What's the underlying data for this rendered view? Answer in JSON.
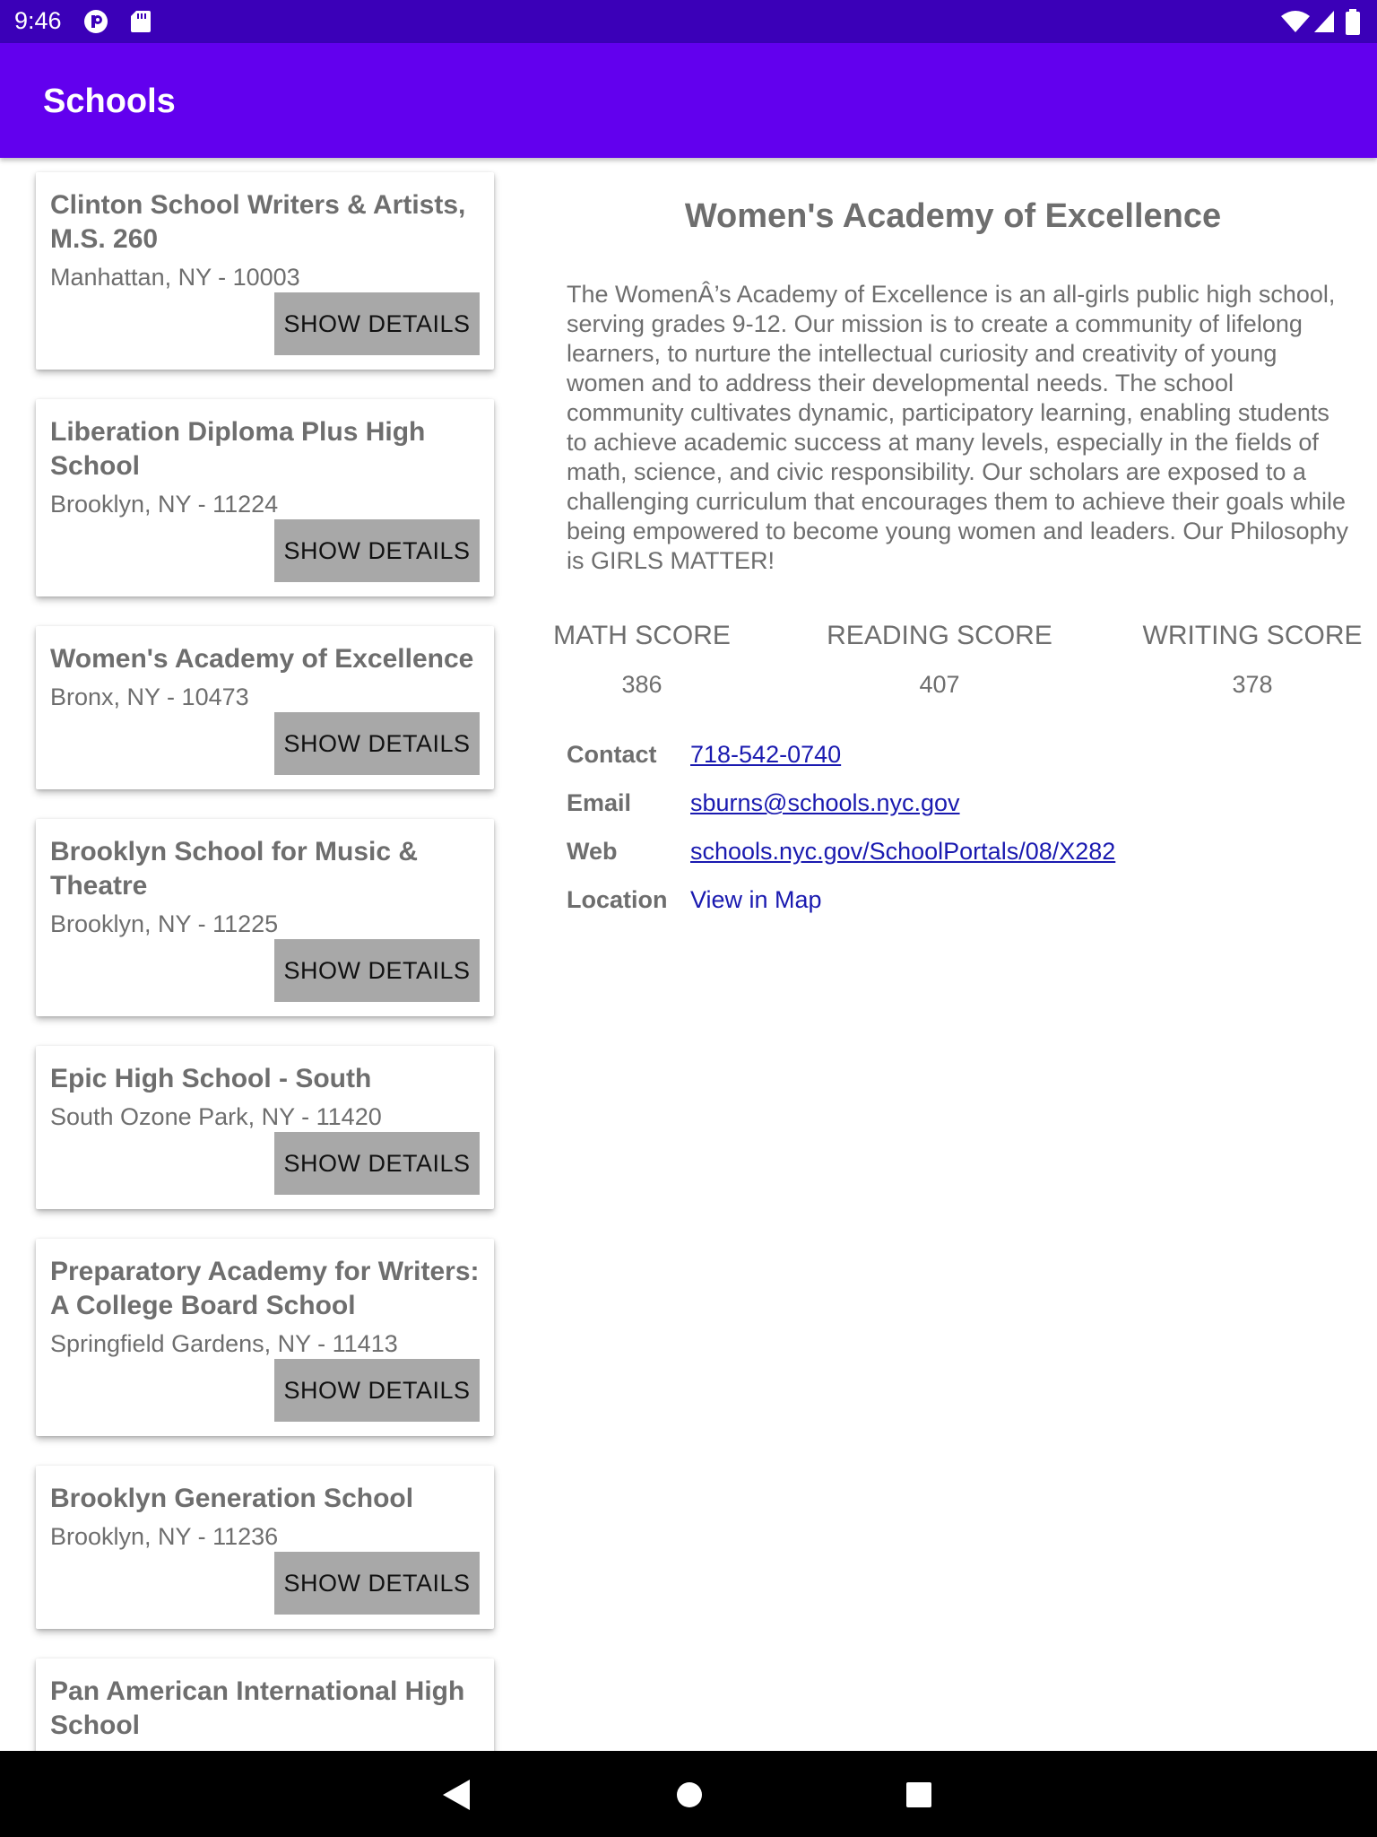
{
  "status_bar": {
    "time": "9:46"
  },
  "app_bar": {
    "title": "Schools"
  },
  "schools": [
    {
      "name": "Clinton School Writers & Artists, M.S. 260",
      "address": "Manhattan, NY - 10003",
      "button": "SHOW DETAILS"
    },
    {
      "name": "Liberation Diploma Plus High School",
      "address": "Brooklyn, NY - 11224",
      "button": "SHOW DETAILS"
    },
    {
      "name": "Women's Academy of Excellence",
      "address": "Bronx, NY - 10473",
      "button": "SHOW DETAILS"
    },
    {
      "name": "Brooklyn School for Music & Theatre",
      "address": "Brooklyn, NY - 11225",
      "button": "SHOW DETAILS"
    },
    {
      "name": "Epic High School - South",
      "address": "South Ozone Park, NY - 11420",
      "button": "SHOW DETAILS"
    },
    {
      "name": "Preparatory Academy for Writers: A College Board School",
      "address": "Springfield Gardens, NY - 11413",
      "button": "SHOW DETAILS"
    },
    {
      "name": "Brooklyn Generation School",
      "address": "Brooklyn, NY - 11236",
      "button": "SHOW DETAILS"
    },
    {
      "name": "Pan American International High School"
    }
  ],
  "detail": {
    "title": "Women's Academy of Excellence",
    "description": "The WomenÂ’s Academy of Excellence is an all-girls public high school, serving grades 9-12. Our mission is to create a community of lifelong learners, to nurture the intellectual curiosity and creativity of young women and to address their developmental needs. The school community cultivates dynamic, participatory learning, enabling students to achieve academic success at many levels, especially in the fields of math, science, and civic responsibility. Our scholars are exposed to a challenging curriculum that encourages them to achieve their goals while being empowered to become young women and leaders. Our Philosophy is GIRLS MATTER!",
    "scores": {
      "math_label": "MATH SCORE",
      "math_value": "386",
      "reading_label": "READING SCORE",
      "reading_value": "407",
      "writing_label": "WRITING SCORE",
      "writing_value": "378"
    },
    "info": {
      "contact_label": "Contact",
      "contact_value": "718-542-0740",
      "email_label": "Email",
      "email_value": "sburns@schools.nyc.gov",
      "web_label": "Web",
      "web_value": "schools.nyc.gov/SchoolPortals/08/X282",
      "location_label": "Location",
      "location_value": "View in Map"
    }
  },
  "icons": [
    "wifi-icon",
    "signal-icon",
    "battery-icon",
    "back-icon",
    "home-icon",
    "recents-icon"
  ]
}
